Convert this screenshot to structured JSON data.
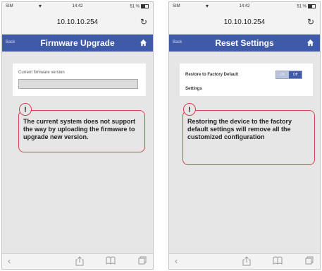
{
  "status": {
    "carrier": "SIM",
    "time": "14:42",
    "battery": "51 %"
  },
  "url": "10.10.10.254",
  "left": {
    "back": "Back",
    "title": "Firmware Upgrade",
    "field_label": "Current firmware version",
    "field_value": "",
    "notice": "The current system does not support the way by uploading the firmware to upgrade new version."
  },
  "right": {
    "back": "Back",
    "title": "Reset Settings",
    "label_line1": "Restore to Factory Default",
    "label_line2": "Settings",
    "toggle_on": "On",
    "toggle_off": "Off",
    "notice": "Restoring the device to the factory default settings will remove all the customized configuration"
  },
  "icons": {
    "warning": "!",
    "reload": "↻",
    "back_arrow": "‹"
  },
  "colors": {
    "nav": "#3e5aa8",
    "alert": "#d2434d"
  }
}
